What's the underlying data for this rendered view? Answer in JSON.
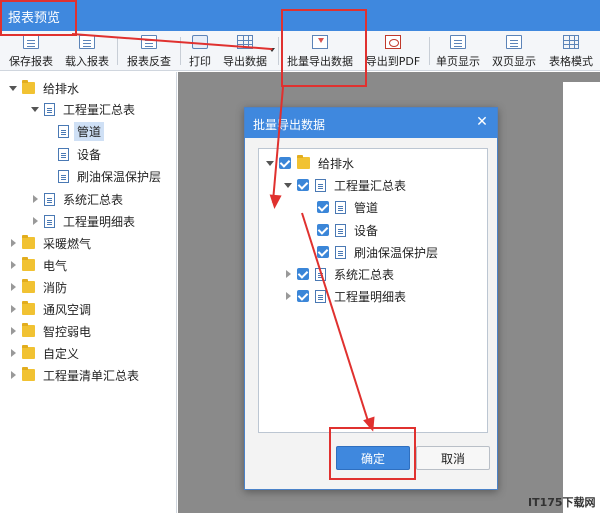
{
  "window": {
    "title": "报表预览"
  },
  "toolbar": {
    "buttons": [
      {
        "label": "保存报表",
        "icon": "save-report-icon"
      },
      {
        "label": "载入报表",
        "icon": "load-report-icon"
      },
      {
        "label": "报表反查",
        "icon": "report-lookup-icon"
      },
      {
        "label": "打印",
        "icon": "print-icon"
      },
      {
        "label": "导出数据",
        "icon": "export-data-icon"
      },
      {
        "label": "批量导出数据",
        "icon": "batch-export-icon"
      },
      {
        "label": "导出到PDF",
        "icon": "pdf-icon"
      },
      {
        "label": "单页显示",
        "icon": "single-page-icon"
      },
      {
        "label": "双页显示",
        "icon": "double-page-icon"
      },
      {
        "label": "表格模式",
        "icon": "table-mode-icon"
      }
    ]
  },
  "left_tree": {
    "items": [
      {
        "label": "给排水",
        "icon": "folder-icon"
      },
      {
        "label": "工程量汇总表",
        "icon": "page-icon"
      },
      {
        "label": "管道",
        "icon": "page-icon",
        "selected": true
      },
      {
        "label": "设备",
        "icon": "page-icon"
      },
      {
        "label": "刷油保温保护层",
        "icon": "page-icon"
      },
      {
        "label": "系统汇总表",
        "icon": "page-icon"
      },
      {
        "label": "工程量明细表",
        "icon": "page-icon"
      },
      {
        "label": "采暖燃气",
        "icon": "folder-icon"
      },
      {
        "label": "电气",
        "icon": "folder-icon"
      },
      {
        "label": "消防",
        "icon": "folder-icon"
      },
      {
        "label": "通风空调",
        "icon": "folder-icon"
      },
      {
        "label": "智控弱电",
        "icon": "folder-icon"
      },
      {
        "label": "自定义",
        "icon": "folder-icon"
      },
      {
        "label": "工程量清单汇总表",
        "icon": "folder-icon"
      }
    ]
  },
  "dialog": {
    "title": "批量导出数据",
    "close_icon": "close-icon",
    "tree": [
      {
        "label": "给排水",
        "checked": true
      },
      {
        "label": "工程量汇总表",
        "checked": true
      },
      {
        "label": "管道",
        "checked": true
      },
      {
        "label": "设备",
        "checked": true
      },
      {
        "label": "刷油保温保护层",
        "checked": true
      },
      {
        "label": "系统汇总表",
        "checked": true
      },
      {
        "label": "工程量明细表",
        "checked": true
      }
    ],
    "ok_label": "确定",
    "cancel_label": "取消"
  },
  "watermark": "IT175下载网",
  "colors": {
    "accent": "#3f88de",
    "annotation": "#e0312f",
    "canvas": "#8a8a8a"
  }
}
